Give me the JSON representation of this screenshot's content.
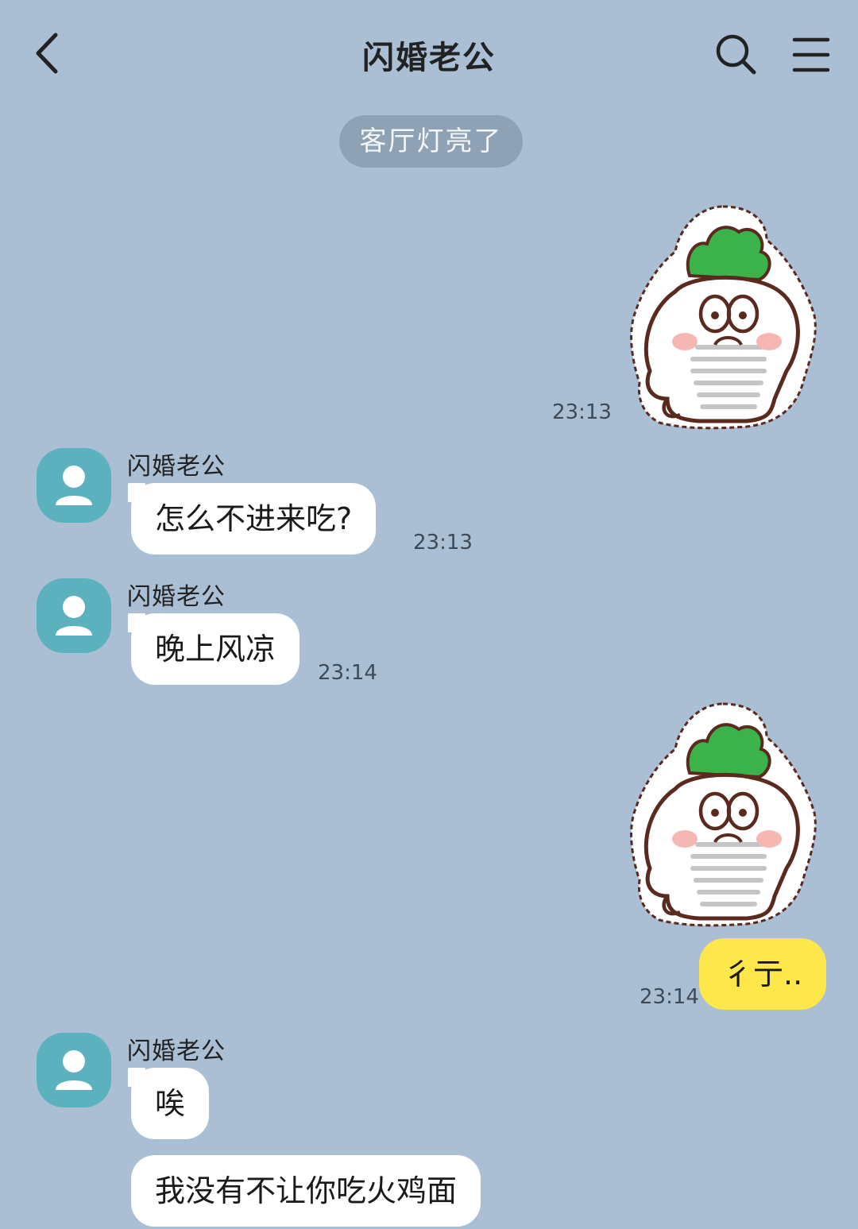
{
  "header": {
    "title": "闪婚老公",
    "back_icon": "chevron-left-icon",
    "search_icon": "search-icon",
    "menu_icon": "menu-icon"
  },
  "system_notice": "客厅灯亮了",
  "colors": {
    "background": "#abbfd4",
    "incoming_bubble": "#ffffff",
    "outgoing_bubble": "#fde74a",
    "avatar": "#5bb1bd",
    "notice_pill": "#8fa2b5"
  },
  "messages": [
    {
      "type": "sticker",
      "from": "me",
      "time": "23:13",
      "sticker": "radish-character-sticker"
    },
    {
      "type": "text",
      "from": "other",
      "sender": "闪婚老公",
      "text": "怎么不进来吃?",
      "time": "23:13"
    },
    {
      "type": "text",
      "from": "other",
      "sender": "闪婚老公",
      "text": "晚上风凉",
      "time": "23:14"
    },
    {
      "type": "sticker",
      "from": "me",
      "time": "",
      "sticker": "radish-character-sticker"
    },
    {
      "type": "text",
      "from": "me",
      "text": "彳亍..",
      "time": "23:14"
    },
    {
      "type": "text",
      "from": "other",
      "sender": "闪婚老公",
      "text": "唉",
      "time": ""
    },
    {
      "type": "text",
      "from": "other",
      "text": "我没有不让你吃火鸡面",
      "time": ""
    }
  ]
}
